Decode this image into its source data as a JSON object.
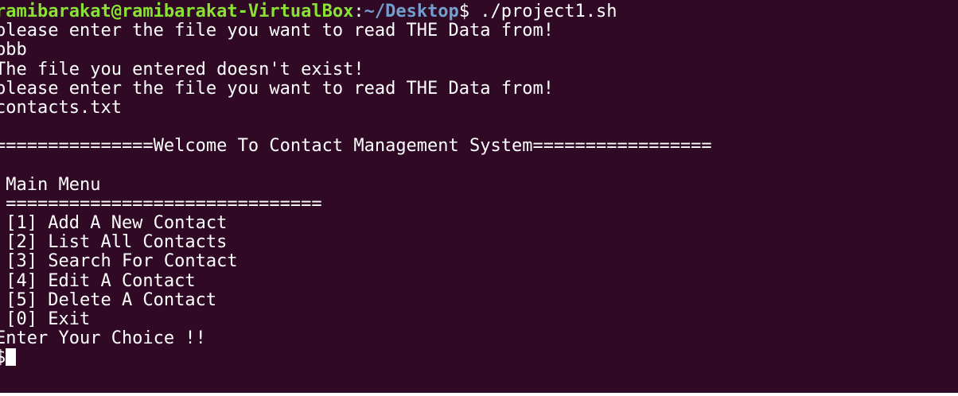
{
  "prompt": {
    "user_host": "ramibarakat@ramibarakat-VirtualBox",
    "colon": ":",
    "path": "~/Desktop",
    "dollar": "$",
    "command": " ./project1.sh"
  },
  "lines": {
    "l1": "please enter the file you want to read THE Data from!",
    "l2": "bbb",
    "l3": "The file you entered doesn't exist!",
    "l4": "please enter the file you want to read THE Data from!",
    "l5": "contacts.txt",
    "blank1": "",
    "banner": "===============Welcome To Contact Management System=================",
    "blank2": "",
    "menu_title": " Main Menu",
    "menu_rule": " ==============================",
    "opt1": " [1] Add A New Contact",
    "opt2": " [2] List All Contacts",
    "opt3": " [3] Search For Contact",
    "opt4": " [4] Edit A Contact",
    "opt5": " [5] Delete A Contact",
    "opt0": " [0] Exit",
    "choice": "Enter Your Choice !!",
    "input_prompt": "$"
  },
  "colors": {
    "background": "#300a24",
    "text": "#ffffff",
    "user_host": "#8ae234",
    "path": "#729fcf"
  }
}
